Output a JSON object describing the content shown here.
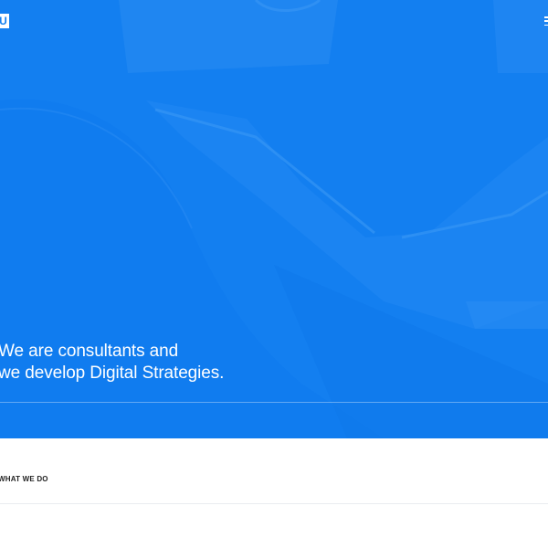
{
  "brand": {
    "logo_text": "U",
    "accent_color": "#137ff0"
  },
  "header": {
    "menu_icon": "hamburger-menu-icon"
  },
  "hero": {
    "headline_line1": "We are consultants and",
    "headline_line2": "we develop Digital Strategies.",
    "background_color": "#137ff0"
  },
  "section": {
    "label": "WHAT WE DO"
  }
}
